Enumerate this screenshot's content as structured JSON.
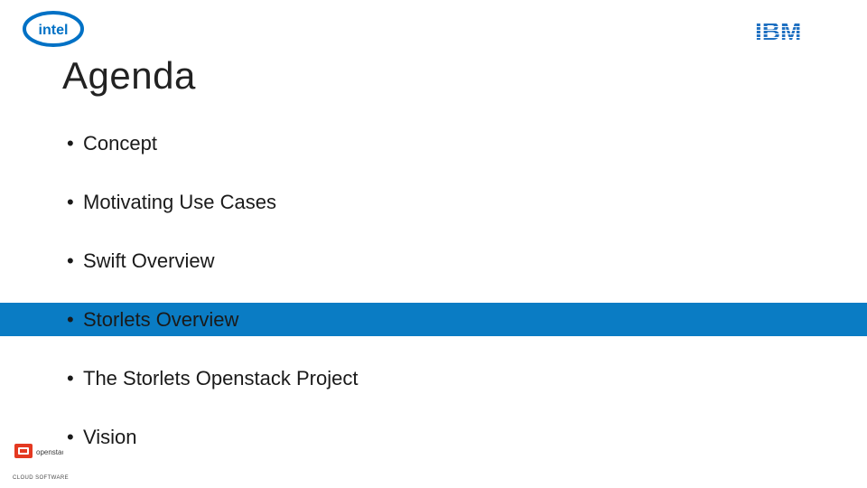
{
  "logos": {
    "intel_name": "intel",
    "ibm_name": "IBM",
    "openstack_name": "openstack",
    "openstack_caption": "CLOUD SOFTWARE"
  },
  "title": "Agenda",
  "agenda": [
    {
      "label": "Concept",
      "highlight": false
    },
    {
      "label": "Motivating Use Cases",
      "highlight": false
    },
    {
      "label": "Swift Overview",
      "highlight": false
    },
    {
      "label": "Storlets Overview",
      "highlight": true
    },
    {
      "label": "The Storlets Openstack Project",
      "highlight": false
    },
    {
      "label": "Vision",
      "highlight": false
    }
  ],
  "colors": {
    "highlight_bg": "#0a7cc4",
    "intel_blue": "#0071c5",
    "ibm_blue": "#1f70c1",
    "openstack_red": "#e43921"
  }
}
